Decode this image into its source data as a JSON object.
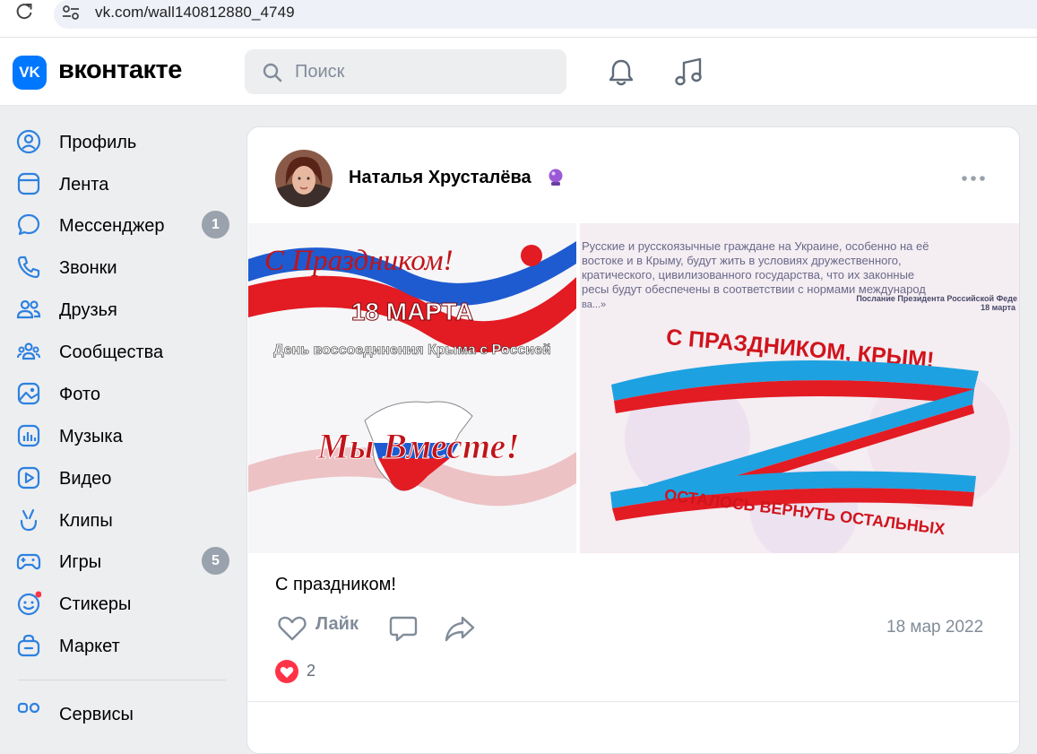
{
  "browser": {
    "url": "vk.com/wall140812880_4749"
  },
  "header": {
    "logo_mark": "VK",
    "logo_text": "вконтакте",
    "search_placeholder": "Поиск",
    "icons": [
      "search-icon",
      "bell-icon",
      "music-note-icon"
    ]
  },
  "sidebar": {
    "items": [
      {
        "label": "Профиль",
        "icon": "user-circle-icon"
      },
      {
        "label": "Лента",
        "icon": "feed-icon"
      },
      {
        "label": "Мессенджер",
        "icon": "chat-bubble-icon",
        "badge": "1"
      },
      {
        "label": "Звонки",
        "icon": "phone-icon"
      },
      {
        "label": "Друзья",
        "icon": "friends-icon"
      },
      {
        "label": "Сообщества",
        "icon": "communities-icon"
      },
      {
        "label": "Фото",
        "icon": "photo-icon"
      },
      {
        "label": "Музыка",
        "icon": "music-icon"
      },
      {
        "label": "Видео",
        "icon": "video-icon"
      },
      {
        "label": "Клипы",
        "icon": "clips-icon"
      },
      {
        "label": "Игры",
        "icon": "gamepad-icon",
        "badge": "5"
      },
      {
        "label": "Стикеры",
        "icon": "sticker-icon"
      },
      {
        "label": "Маркет",
        "icon": "bag-icon"
      },
      {
        "label": "Сервисы",
        "icon": "services-icon"
      }
    ]
  },
  "post": {
    "author": "Наталья Хрусталёва",
    "text": "С праздником!",
    "like_label": "Лайк",
    "date": "18 мар 2022",
    "reaction_count": "2",
    "photo1": {
      "headline": "С Праздником!",
      "date_line": "18 МАРТА",
      "subtitle": "День воссоединения Крыма с Россией",
      "slogan": "Мы Вместе!"
    },
    "photo2": {
      "quote_lines": [
        "Русские и русскоязычные граждане на Украине, особенно на её",
        "востоке и в Крыму, будут жить в условиях дружественного,",
        "кратического, цивилизованного государства, что их законные",
        "ресы будут обеспечены в соответствии с нормами международ",
        "ва...»"
      ],
      "quote_source": "Послание Президента Российской Феде",
      "quote_date": "18 марта",
      "headline": "С ПРАЗДНИКОМ, КРЫМ!",
      "bottom_line": "ОСТАЛОСЬ ВЕРНУТЬ ОСТАЛЬНЫХ"
    }
  },
  "colors": {
    "accent": "#0077ff",
    "secondary_text": "#818c99",
    "badge": "#99a2ad",
    "red": "#e31b23",
    "blue": "#1565c0"
  }
}
